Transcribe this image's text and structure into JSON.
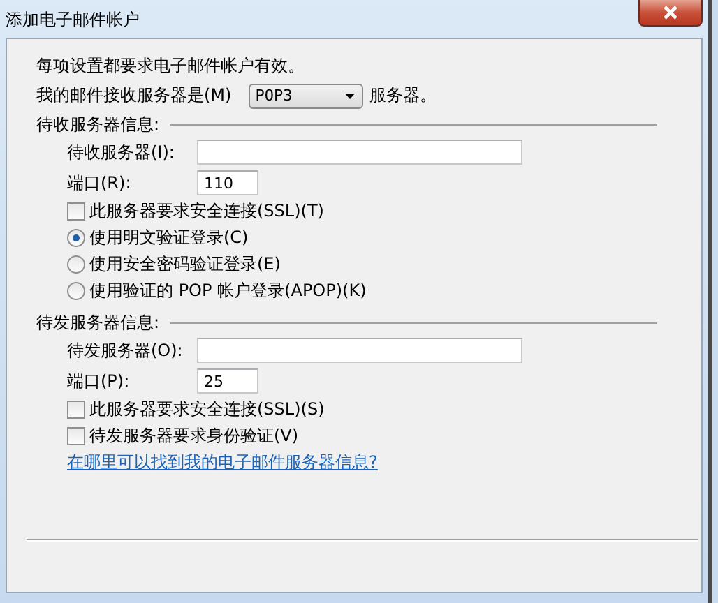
{
  "window": {
    "title": "添加电子邮件帐户"
  },
  "intro": "每项设置都要求电子邮件帐户有效。",
  "server_type": {
    "label": "我的邮件接收服务器是(M)",
    "value": "POP3",
    "suffix": "服务器。"
  },
  "incoming": {
    "heading": "待收服务器信息:",
    "server": {
      "label": "待收服务器(I):"
    },
    "port": {
      "label": "端口(R):",
      "value": "110"
    },
    "options": [
      {
        "kind": "checkbox",
        "label": "此服务器要求安全连接(SSL)(T)",
        "checked": false
      },
      {
        "kind": "radio",
        "label": "使用明文验证登录(C)",
        "selected": true
      },
      {
        "kind": "radio",
        "label": "使用安全密码验证登录(E)",
        "selected": false
      },
      {
        "kind": "radio",
        "label": "使用验证的 POP 帐户登录(APOP)(K)",
        "selected": false
      }
    ]
  },
  "outgoing": {
    "heading": "待发服务器信息:",
    "server": {
      "label": "待发服务器(O):"
    },
    "port": {
      "label": "端口(P):",
      "value": "25"
    },
    "options": [
      {
        "kind": "checkbox",
        "label": "此服务器要求安全连接(SSL)(S)",
        "checked": false
      },
      {
        "kind": "checkbox",
        "label": "待发服务器要求身份验证(V)",
        "checked": false
      }
    ]
  },
  "help_link": "在哪里可以找到我的电子邮件服务器信息?"
}
